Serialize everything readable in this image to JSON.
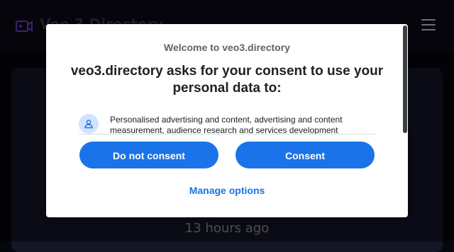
{
  "background_page": {
    "site_title": "Veo 3 Directory",
    "timestamp": "13 hours ago",
    "logo_icon": "video-camera-icon",
    "menu_icon": "hamburger-menu-icon"
  },
  "consent_dialog": {
    "site_name": "Welcome to veo3.directory",
    "heading": "veo3.directory asks for your consent to use your personal data to:",
    "purposes": [
      {
        "icon": "person-icon",
        "text": "Personalised advertising and content, advertising and content measurement, audience research and services development"
      }
    ],
    "buttons": {
      "do_not_consent": "Do not consent",
      "consent": "Consent"
    },
    "manage_options": "Manage options"
  },
  "colors": {
    "primary_button": "#1a73e8",
    "page_background": "#06060d",
    "accent_logo": "#6a3fd0"
  }
}
